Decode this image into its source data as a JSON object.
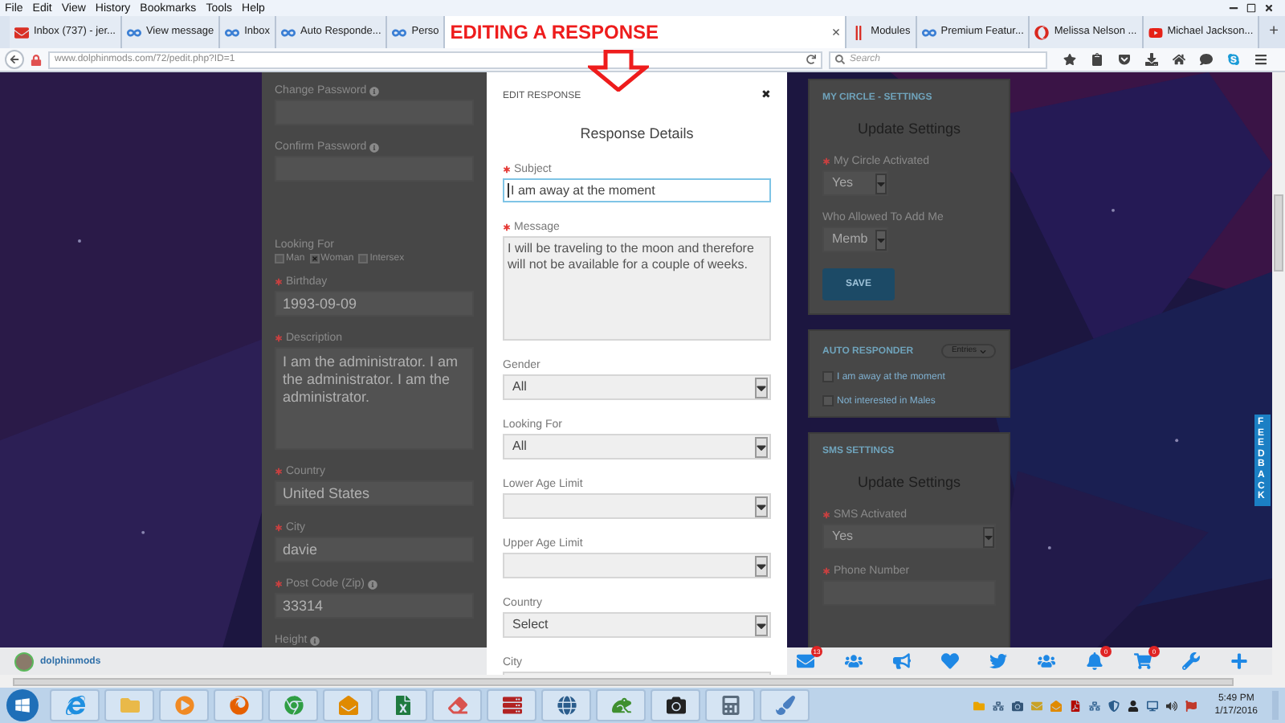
{
  "menu": [
    "File",
    "Edit",
    "View",
    "History",
    "Bookmarks",
    "Tools",
    "Help"
  ],
  "tabs": [
    {
      "label": "Inbox (737) - jer...",
      "kind": "mail",
      "selected": false
    },
    {
      "label": "View message",
      "kind": "dolphin",
      "selected": false
    },
    {
      "label": "Inbox",
      "kind": "dolphin",
      "selected": false
    },
    {
      "label": "Auto Responde...",
      "kind": "dolphin",
      "selected": false
    },
    {
      "label": "Perso",
      "kind": "dolphin",
      "selected": false
    },
    {
      "kind": "blank",
      "selected": true,
      "close": "×"
    },
    {
      "label": "Modules",
      "kind": "modules",
      "selected": false
    },
    {
      "label": "Premium Featur...",
      "kind": "dolphin",
      "selected": false
    },
    {
      "label": "Melissa Nelson ...",
      "kind": "opera",
      "selected": false
    },
    {
      "label": "Michael Jackson...",
      "kind": "video",
      "selected": false
    }
  ],
  "new_tab": "+",
  "annotation": {
    "text": "EDITING A RESPONSE"
  },
  "address": {
    "url_host": "www.dolphinmods.com",
    "url_path": "/72/pedit.php?ID=1",
    "search_placeholder": "Search"
  },
  "profile_form": [
    {
      "kind": "input",
      "label": "Change Password",
      "required": false,
      "info": true
    },
    {
      "kind": "input",
      "label": "Confirm Password",
      "required": false,
      "info": true
    },
    {
      "kind": "gap"
    },
    {
      "kind": "checkboxes",
      "label": "Looking For",
      "required": false,
      "info": false,
      "options": [
        {
          "label": "Man",
          "checked": false
        },
        {
          "label": "Woman",
          "checked": true
        },
        {
          "label": "Intersex",
          "checked": false
        }
      ]
    },
    {
      "kind": "input",
      "label": "Birthday",
      "required": true,
      "info": false,
      "value": "1993-09-09"
    },
    {
      "kind": "textarea",
      "label": "Description",
      "required": true,
      "info": false,
      "value": "I am the administrator. I am the administrator. I am the administrator."
    },
    {
      "kind": "input",
      "label": "Country",
      "required": true,
      "info": false,
      "value": "United States"
    },
    {
      "kind": "input",
      "label": "City",
      "required": true,
      "info": false,
      "value": "davie"
    },
    {
      "kind": "input",
      "label": "Post Code (Zip)",
      "required": true,
      "info": true,
      "value": "33314"
    },
    {
      "kind": "label",
      "label": "Height",
      "required": false,
      "info": true
    }
  ],
  "modal": {
    "header": "EDIT RESPONSE",
    "close": "✖",
    "title": "Response Details",
    "fields": [
      {
        "kind": "input",
        "label": "Subject",
        "required": true,
        "value": "I am away at the moment",
        "focused": true
      },
      {
        "kind": "textarea",
        "label": "Message",
        "required": true,
        "value": "I will be traveling to the moon and therefore will not be available for a couple of weeks.",
        "focused": false
      },
      {
        "kind": "select",
        "label": "Gender",
        "required": false,
        "value": "All",
        "focused": false
      },
      {
        "kind": "select",
        "label": "Looking For",
        "required": false,
        "value": "All",
        "focused": false
      },
      {
        "kind": "select",
        "label": "Lower Age Limit",
        "required": false,
        "focused": false
      },
      {
        "kind": "select",
        "label": "Upper Age Limit",
        "required": false,
        "focused": false
      },
      {
        "kind": "select",
        "label": "Country",
        "required": false,
        "value": "Select",
        "focused": false
      },
      {
        "kind": "input",
        "label": "City",
        "required": false,
        "focused": false
      }
    ]
  },
  "circle_settings": {
    "header": "MY CIRCLE - SETTINGS",
    "title": "Update Settings",
    "fields": [
      {
        "label": "My Circle Activated",
        "required": true,
        "value": "Yes"
      },
      {
        "label": "Who Allowed To Add Me",
        "required": false,
        "value": "Memb"
      }
    ],
    "button": "SAVE"
  },
  "auto_responder": {
    "header": "AUTO RESPONDER",
    "dropdown": "Entries",
    "entries": [
      {
        "label": "I am away at the moment",
        "checked": false
      },
      {
        "label": "Not interested in Males",
        "checked": false
      }
    ]
  },
  "sms_settings": {
    "header": "SMS SETTINGS",
    "title": "Update Settings",
    "fields": [
      {
        "kind": "select",
        "label": "SMS Activated",
        "required": true,
        "value": "Yes"
      },
      {
        "kind": "input",
        "label": "Phone Number",
        "required": true
      }
    ]
  },
  "feedback": "FEEDBACK",
  "site_bar": {
    "user": "dolphinmods",
    "icons": [
      {
        "kind": "mail",
        "badge": "13"
      },
      {
        "kind": "people"
      },
      {
        "kind": "megaphone"
      },
      {
        "kind": "heart"
      },
      {
        "kind": "bird"
      },
      {
        "kind": "people"
      },
      {
        "kind": "bell",
        "badge": "0"
      },
      {
        "kind": "cart",
        "badge": "0"
      },
      {
        "kind": "wrench"
      },
      {
        "kind": "plus"
      }
    ]
  },
  "taskbar": {
    "time": "5:49 PM",
    "date": "1/17/2016"
  }
}
